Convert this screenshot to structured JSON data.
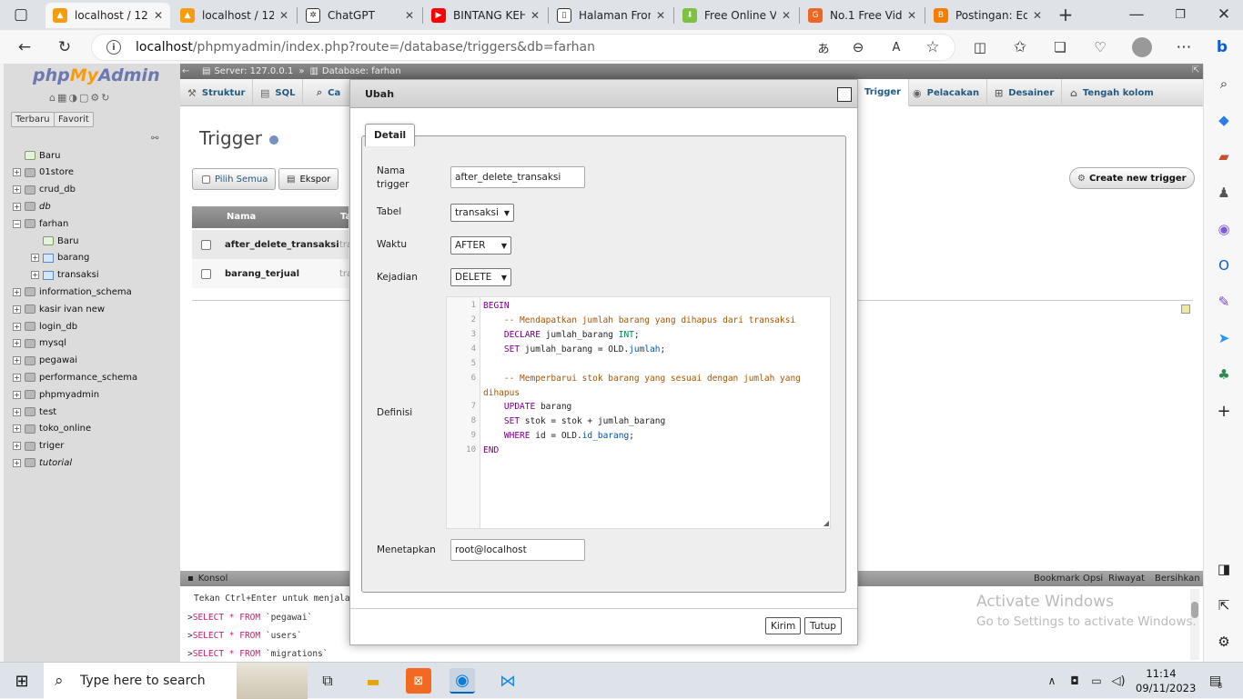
{
  "browser": {
    "tabs": [
      {
        "title": "localhost / 12",
        "active": true,
        "icon": "pma-icon"
      },
      {
        "title": "localhost / 12",
        "active": false,
        "icon": "pma-icon"
      },
      {
        "title": "ChatGPT",
        "active": false,
        "icon": "chatgpt-icon"
      },
      {
        "title": "BINTANG KEH",
        "active": false,
        "icon": "youtube-icon"
      },
      {
        "title": "Halaman Fron",
        "active": false,
        "icon": "document-icon"
      },
      {
        "title": "Free Online Vi",
        "active": false,
        "icon": "download-icon"
      },
      {
        "title": "No.1 Free Vid",
        "active": false,
        "icon": "g-icon"
      },
      {
        "title": "Postingan: Ed",
        "active": false,
        "icon": "blogger-icon"
      }
    ],
    "url_host": "localhost",
    "url_path": "/phpmyadmin/index.php?route=/database/triggers&db=farhan"
  },
  "pma": {
    "logo_php": "php",
    "logo_my": "My",
    "logo_admin": "Admin",
    "left_tabs": [
      "Terbaru",
      "Favorit"
    ],
    "tree": [
      {
        "label": "Baru",
        "level": 0,
        "type": "new"
      },
      {
        "label": "01store",
        "level": 0,
        "type": "db"
      },
      {
        "label": "crud_db",
        "level": 0,
        "type": "db"
      },
      {
        "label": "db",
        "level": 0,
        "type": "db",
        "italic": true
      },
      {
        "label": "farhan",
        "level": 0,
        "type": "db",
        "expanded": true
      },
      {
        "label": "Baru",
        "level": 1,
        "type": "new"
      },
      {
        "label": "barang",
        "level": 1,
        "type": "table"
      },
      {
        "label": "transaksi",
        "level": 1,
        "type": "table"
      },
      {
        "label": "information_schema",
        "level": 0,
        "type": "db"
      },
      {
        "label": "kasir ivan new",
        "level": 0,
        "type": "db"
      },
      {
        "label": "login_db",
        "level": 0,
        "type": "db"
      },
      {
        "label": "mysql",
        "level": 0,
        "type": "db"
      },
      {
        "label": "pegawai",
        "level": 0,
        "type": "db"
      },
      {
        "label": "performance_schema",
        "level": 0,
        "type": "db"
      },
      {
        "label": "phpmyadmin",
        "level": 0,
        "type": "db"
      },
      {
        "label": "test",
        "level": 0,
        "type": "db"
      },
      {
        "label": "toko_online",
        "level": 0,
        "type": "db"
      },
      {
        "label": "triger",
        "level": 0,
        "type": "db"
      },
      {
        "label": "tutorial",
        "level": 0,
        "type": "db",
        "italic": true
      }
    ],
    "breadcrumb_server": "Server: 127.0.0.1",
    "breadcrumb_sep": "»",
    "breadcrumb_db": "Database: farhan",
    "menu": [
      "Struktur",
      "SQL",
      "Ca",
      "Trigger",
      "Pelacakan",
      "Desainer",
      "Tengah kolom"
    ],
    "page_title": "Trigger",
    "select_all": "Pilih Semua",
    "export": "Ekspor",
    "create_trigger": "Create new trigger",
    "table_headers": [
      "Nama",
      "Ta"
    ],
    "triggers": [
      {
        "name": "after_delete_transaksi",
        "table": "tra"
      },
      {
        "name": "barang_terjual",
        "table": "tra"
      }
    ],
    "console_label": "Konsol",
    "console_links": [
      "Bookmark",
      "Opsi",
      "Riwayat",
      "Bersihkan"
    ],
    "console_hint": "Tekan Ctrl+Enter untuk menjala",
    "console_lines": [
      {
        "prompt": ">",
        "kw1": "SELECT",
        "star": " * ",
        "kw2": "FROM",
        "rest": " `pegawai`"
      },
      {
        "prompt": ">",
        "kw1": "SELECT",
        "star": " * ",
        "kw2": "FROM",
        "rest": " `users`"
      },
      {
        "prompt": ">",
        "kw1": "SELECT",
        "star": " * ",
        "kw2": "FROM",
        "rest": " `migrations`"
      }
    ],
    "activate_title": "Activate Windows",
    "activate_sub": "Go to Settings to activate Windows."
  },
  "dialog": {
    "title": "Ubah",
    "legend": "Detail",
    "labels": {
      "name": "Nama\ntrigger",
      "table": "Tabel",
      "time": "Waktu",
      "event": "Kejadian",
      "definition": "Definisi",
      "definer": "Menetapkan"
    },
    "values": {
      "name": "after_delete_transaksi",
      "table": "transaksi",
      "time": "AFTER",
      "event": "DELETE",
      "definer": "root@localhost"
    },
    "code_line_numbers": [
      "1",
      "2",
      "3",
      "4",
      "5",
      "6",
      "",
      "7",
      "8",
      "9",
      "10"
    ],
    "buttons": {
      "submit": "Kirim",
      "close": "Tutup"
    }
  },
  "taskbar": {
    "search_placeholder": "Type here to search",
    "time": "11:14",
    "date": "09/11/2023",
    "notif_count": "8"
  }
}
